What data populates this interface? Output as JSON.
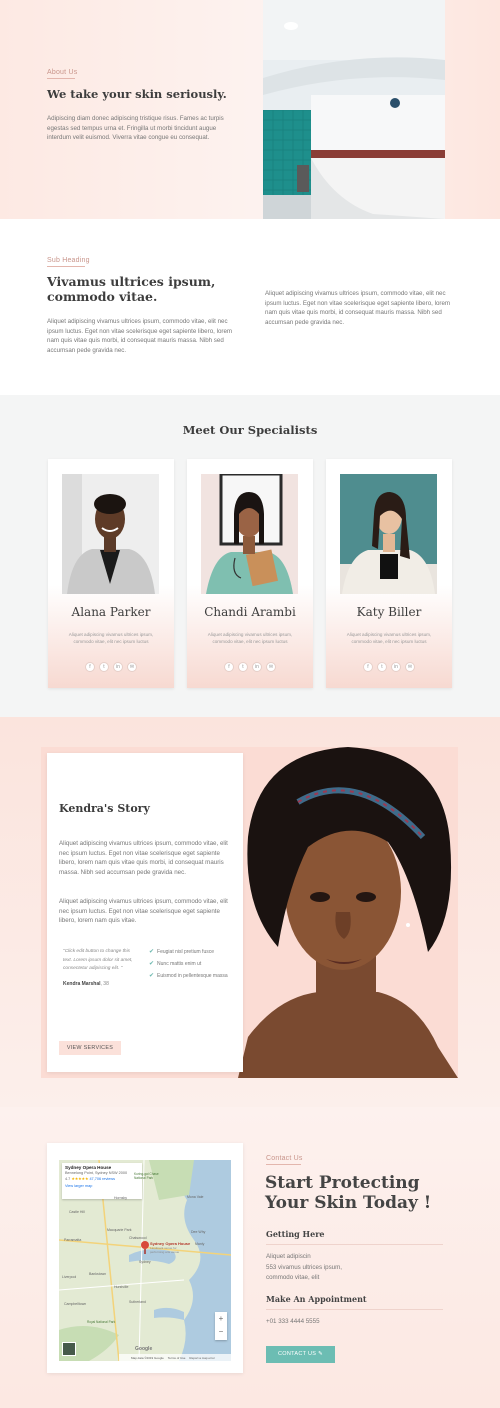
{
  "about": {
    "eyebrow": "About Us",
    "heading": "We take your skin seriously.",
    "body": "Adipiscing diam donec adipiscing tristique risus. Fames ac turpis egestas sed tempus urna et. Fringilla ut morbi tincidunt augue interdum velit euismod. Viverra vitae congue eu consequat."
  },
  "intro": {
    "eyebrow": "Sub Heading",
    "heading_line1": "Vivamus ultrices ipsum,",
    "heading_line2": "commodo vitae.",
    "left_body": "Aliquet adipiscing vivamus ultrices ipsum, commodo vitae, elit nec ipsum luctus. Eget non vitae scelerisque eget sapiente libero, lorem nam quis vitae quis morbi, id consequat mauris massa. Nibh sed accumsan pede gravida nec.",
    "right_body": "Aliquet adipiscing vivamus ultrices ipsum, commodo vitae, elit nec ipsum luctus. Eget non vitae scelerisque eget sapiente libero, lorem nam quis vitae quis morbi, id consequat mauris massa. Nibh sed accumsan pede gravida nec."
  },
  "specialists": {
    "heading": "Meet Our Specialists",
    "cards": [
      {
        "name": "Alana Parker",
        "desc": "Aliquet adipiscing vivamus ultrices ipsum, commodo vitae, elit nec ipsum luctus"
      },
      {
        "name": "Chandi Arambi",
        "desc": "Aliquet adipiscing vivamus ultrices ipsum, commodo vitae, elit nec ipsum luctus"
      },
      {
        "name": "Katy Biller",
        "desc": "Aliquet adipiscing vivamus ultrices ipsum, commodo vitae, elit nec ipsum luctus"
      }
    ],
    "social_icons": [
      "facebook-icon",
      "twitter-icon",
      "linkedin-icon",
      "email-icon"
    ]
  },
  "story": {
    "heading": "Kendra's Story",
    "para1": "Aliquet adipiscing vivamus ultrices ipsum, commodo vitae, elit nec ipsum luctus. Eget non vitae scelerisque eget sapiente libero, lorem nam quis vitae quis morbi, id consequat mauris massa. Nibh sed accumsan pede gravida nec.",
    "para2": "Aliquet adipiscing vivamus ultrices ipsum, commodo vitae, elit nec ipsum luctus. Eget non vitae scelerisque eget sapiente libero, lorem nam quis vitae.",
    "quote": "\"Click edit button to change this text. Lorem ipsum dolor sit amet, consectetur adipiscing elit. \"",
    "quote_author": "Kendra Marshal",
    "quote_age": ", 38",
    "checklist": [
      "Feugiat nisl pretium fusce",
      "Nunc mattis enim ut",
      "Euismod in pellentesque massa"
    ],
    "button": "VIEW SERVICES"
  },
  "contact": {
    "eyebrow": "Contact Us",
    "heading_line1": "Start Protecting",
    "heading_line2": "Your Skin Today !",
    "getting_here": "Getting Here",
    "address_line1": "Aliquet adipiscin",
    "address_line2": "553 vivamus ultrices ipsum,",
    "address_line3": "commodo vitae, elit",
    "appointment": "Make An Appointment",
    "phone": "+01 333 4444 5555",
    "button": "CONTACT US"
  },
  "map": {
    "place_name": "Sydney Opera House",
    "place_address": "Bennelong Point, Sydney NSW 2000",
    "rating": "4.7",
    "stars": "★★★★★",
    "reviews": "47,706 reviews",
    "larger_map": "View larger map",
    "pin_label": "Sydney Opera House",
    "pin_sub": "Landmark venue for performing arts venue",
    "zoom_in": "+",
    "zoom_out": "−",
    "google": "Google",
    "map_data": "Map data ©2019 Google",
    "terms": "Terms of Use",
    "report": "Report a map error",
    "labels": [
      "Kuring-gai Chase National Park",
      "Castle Hill",
      "Hornsby",
      "Mona Vale",
      "Dee Why",
      "Manly",
      "Parramatta",
      "Macquarie Park",
      "Chatswood",
      "Bankstown",
      "Sydney",
      "Hurstville",
      "Liverpool",
      "Royal National Park",
      "Campbelltown",
      "Sutherland"
    ]
  },
  "colors": {
    "accent_teal": "#6cbdb3",
    "accent_pink": "#fbe1da",
    "heading": "#3d3d3d"
  }
}
